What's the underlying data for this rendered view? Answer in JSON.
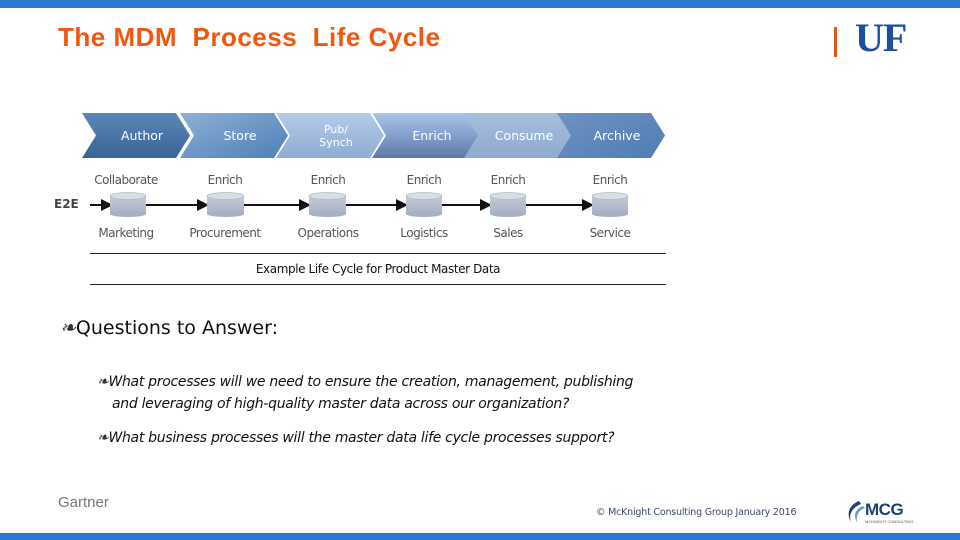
{
  "header": {
    "title": "The MDM  Process  Life Cycle",
    "logo_text": "UF"
  },
  "colors": {
    "accent_bar": "#2a7bd1",
    "title": "#f2560f",
    "uf_blue": "#1f4e9a"
  },
  "diagram": {
    "chevrons": [
      {
        "label": "Author"
      },
      {
        "label": "Store"
      },
      {
        "label": "Pub/\nSynch"
      },
      {
        "label": "Enrich"
      },
      {
        "label": "Consume"
      },
      {
        "label": "Archive"
      }
    ],
    "flow_label": "E2E",
    "stages": [
      {
        "activity": "Collaborate",
        "department": "Marketing"
      },
      {
        "activity": "Enrich",
        "department": "Procurement"
      },
      {
        "activity": "Enrich",
        "department": "Operations"
      },
      {
        "activity": "Enrich",
        "department": "Logistics"
      },
      {
        "activity": "Enrich",
        "department": "Sales"
      },
      {
        "activity": "Enrich",
        "department": "Service"
      }
    ],
    "caption": "Example Life Cycle for Product Master Data"
  },
  "questions": {
    "bullet_glyph": "❧",
    "heading": "Questions to Answer:",
    "items": [
      {
        "line1": "What processes will we need to ensure  the creation, management,  publishing",
        "line2": "and leveraging of high-quality master data across our organization?"
      },
      {
        "line1": "What business processes will the master data life cycle processes support?"
      }
    ]
  },
  "footer": {
    "source": "Gartner",
    "copyright": "© McKnight Consulting Group January 2016",
    "logo_text": "MCG",
    "logo_subtext": "MCKNIGHT CONSULTING"
  }
}
